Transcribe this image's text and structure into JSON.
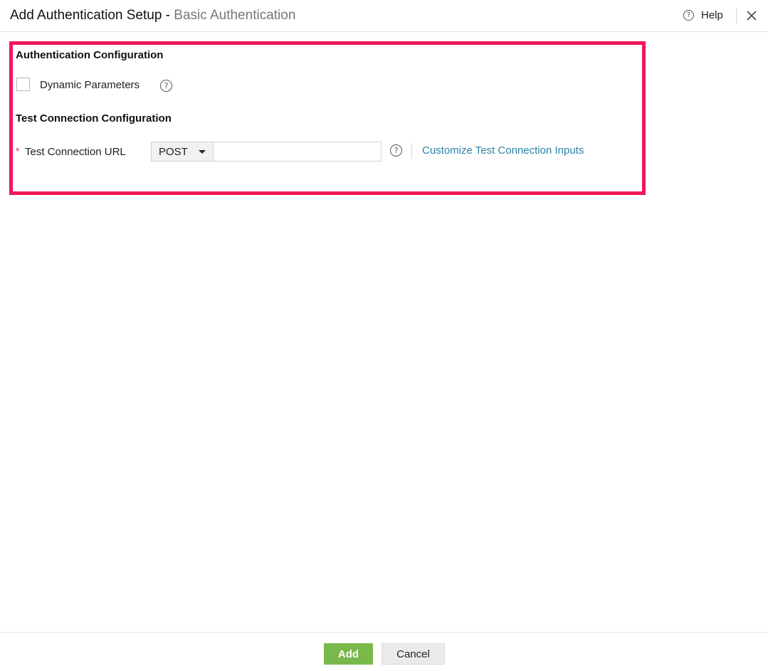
{
  "header": {
    "title_main": "Add Authentication Setup",
    "title_separator": " - ",
    "title_sub": "Basic Authentication",
    "help_label": "Help",
    "help_icon": "question-circle-icon",
    "close_icon": "close-icon"
  },
  "auth_config": {
    "heading": "Authentication Configuration",
    "dynamic_parameters_label": "Dynamic Parameters",
    "dynamic_parameters_checked": false
  },
  "test_connection": {
    "heading": "Test Connection Configuration",
    "required_marker": "*",
    "url_label": "Test Connection URL",
    "method_selected": "POST",
    "url_value": "",
    "customize_link": "Customize Test Connection Inputs"
  },
  "footer": {
    "add_label": "Add",
    "cancel_label": "Cancel"
  },
  "colors": {
    "highlight_border": "#f0185a",
    "add_button": "#79b84a",
    "link": "#2a83a8",
    "required": "#e2355a"
  }
}
